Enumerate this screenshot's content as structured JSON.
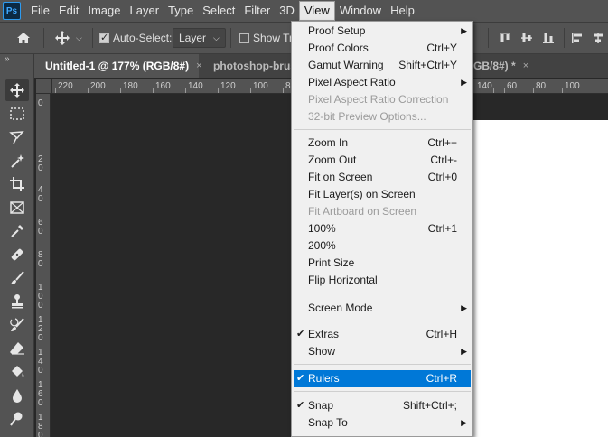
{
  "app": {
    "logo": "Ps"
  },
  "menubar": {
    "items": [
      {
        "label": "File"
      },
      {
        "label": "Edit"
      },
      {
        "label": "Image"
      },
      {
        "label": "Layer"
      },
      {
        "label": "Type"
      },
      {
        "label": "Select"
      },
      {
        "label": "Filter"
      },
      {
        "label": "3D"
      },
      {
        "label": "View"
      },
      {
        "label": "Window"
      },
      {
        "label": "Help"
      }
    ],
    "active": "View"
  },
  "options": {
    "home_icon": "home-icon",
    "move_icon": "move-tool-icon",
    "auto_select_label": "Auto-Select:",
    "auto_select_checked": true,
    "auto_select_target": "Layer",
    "show_transform_label": "Show Tra",
    "show_transform_checked": false
  },
  "tabs": [
    {
      "label": "Untitled-1 @ 177% (RGB/8#)",
      "close": "×",
      "active": true
    },
    {
      "label": "photoshop-brush",
      "active": false
    },
    {
      "label": "GB/8#) *",
      "close": "×",
      "active": false
    }
  ],
  "rulers": {
    "h_left": [
      "220",
      "200",
      "180",
      "160",
      "140",
      "120",
      "100",
      "8"
    ],
    "h_right": [
      "140",
      "60",
      "80",
      "100"
    ],
    "v": [
      "0",
      "2",
      "0",
      "4",
      "0",
      "6",
      "0",
      "8",
      "0",
      "1 0 0",
      "1 2 0",
      "1 4 0",
      "1 6 0",
      "1 8 0"
    ]
  },
  "toolbar": {
    "collapse": "»",
    "tools": [
      "move-tool-icon",
      "marquee-tool-icon",
      "lasso-tool-icon",
      "magic-wand-tool-icon",
      "crop-tool-icon",
      "frame-tool-icon",
      "eyedropper-tool-icon",
      "healing-brush-tool-icon",
      "brush-tool-icon",
      "clone-stamp-tool-icon",
      "history-brush-tool-icon",
      "eraser-tool-icon",
      "paint-bucket-tool-icon",
      "blur-tool-icon",
      "dodge-tool-icon"
    ]
  },
  "view_menu": {
    "items": [
      {
        "label": "Proof Setup",
        "submenu": "▶"
      },
      {
        "label": "Proof Colors",
        "shortcut": "Ctrl+Y"
      },
      {
        "label": "Gamut Warning",
        "shortcut": "Shift+Ctrl+Y"
      },
      {
        "label": "Pixel Aspect Ratio",
        "submenu": "▶"
      },
      {
        "label": "Pixel Aspect Ratio Correction",
        "disabled": true
      },
      {
        "label": "32-bit Preview Options...",
        "disabled": true
      },
      {
        "label": "Zoom In",
        "shortcut": "Ctrl++"
      },
      {
        "label": "Zoom Out",
        "shortcut": "Ctrl+-"
      },
      {
        "label": "Fit on Screen",
        "shortcut": "Ctrl+0"
      },
      {
        "label": "Fit Layer(s) on Screen"
      },
      {
        "label": "Fit Artboard on Screen",
        "disabled": true
      },
      {
        "label": "100%",
        "shortcut": "Ctrl+1"
      },
      {
        "label": "200%"
      },
      {
        "label": "Print Size"
      },
      {
        "label": "Flip Horizontal"
      },
      {
        "label": "Screen Mode",
        "submenu": "▶"
      },
      {
        "label": "Extras",
        "shortcut": "Ctrl+H",
        "check": "✔"
      },
      {
        "label": "Show",
        "submenu": "▶"
      },
      {
        "label": "Rulers",
        "shortcut": "Ctrl+R",
        "check": "✔",
        "highlighted": true
      },
      {
        "label": "Snap",
        "shortcut": "Shift+Ctrl+;",
        "check": "✔"
      },
      {
        "label": "Snap To",
        "submenu": "▶"
      }
    ]
  },
  "colors": {
    "chrome": "#535353",
    "workspace": "#282828",
    "menu_bg": "#f0f0f0",
    "highlight": "#0078d7"
  }
}
